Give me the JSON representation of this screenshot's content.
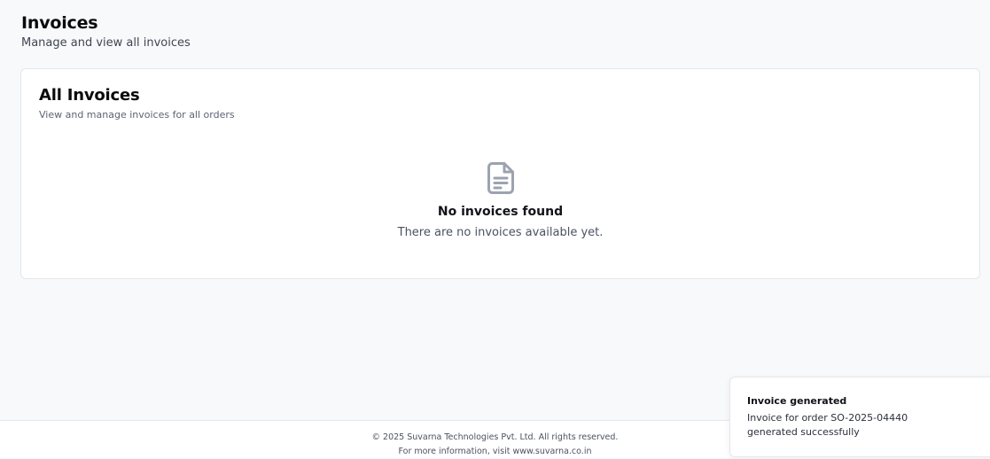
{
  "header": {
    "title": "Invoices",
    "subtitle": "Manage and view all invoices"
  },
  "card": {
    "title": "All Invoices",
    "subtitle": "View and manage invoices for all orders",
    "empty_state": {
      "icon": "file-text-icon",
      "title": "No invoices found",
      "description": "There are no invoices available yet."
    }
  },
  "footer": {
    "copyright": "© 2025 Suvarna Technologies Pvt. Ltd. All rights reserved.",
    "info": "For more information, visit www.suvarna.co.in"
  },
  "toast": {
    "title": "Invoice generated",
    "message": "Invoice for order SO-2025-04440 generated successfully"
  },
  "colors": {
    "background": "#f8f9fb",
    "card": "#ffffff",
    "border": "#e4e7ec",
    "icon": "#9ca3af"
  }
}
